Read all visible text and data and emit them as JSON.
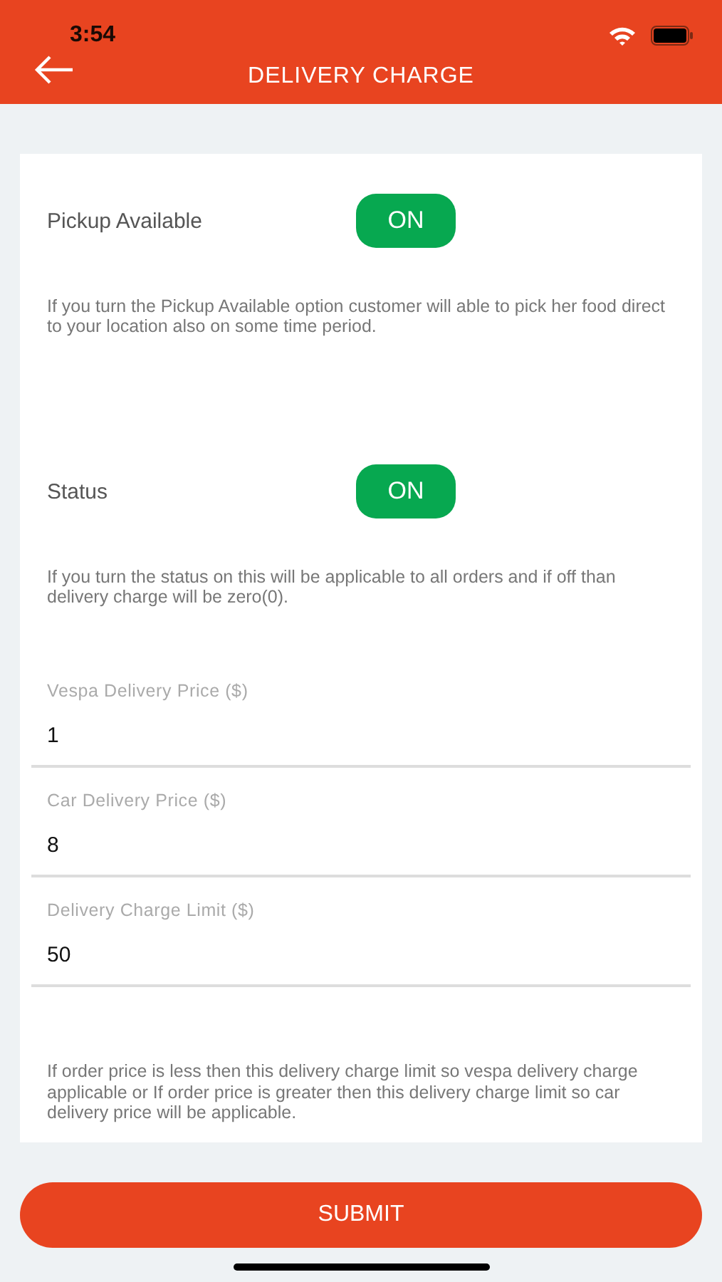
{
  "status_bar": {
    "time": "3:54"
  },
  "header": {
    "title": "DELIVERY CHARGE"
  },
  "toggles": [
    {
      "label": "Pickup Available",
      "on": true,
      "switch_text": "ON",
      "description": "If you turn the Pickup Available option customer will able to pick her food direct to your location also on some time period."
    },
    {
      "label": "Status",
      "on": true,
      "switch_text": "ON",
      "description": "If you turn the status on this will be applicable to all orders and if off than delivery charge will be zero(0)."
    }
  ],
  "fields": [
    {
      "label": "Vespa Delivery Price ($)",
      "value": "1"
    },
    {
      "label": "Car Delivery Price ($)",
      "value": "8"
    },
    {
      "label": "Delivery Charge Limit ($)",
      "value": "50"
    }
  ],
  "note": "If order price is less then this delivery charge limit so vespa delivery charge applicable or If order price is greater then this delivery charge limit so car delivery price will be applicable.",
  "submit_button": "SUBMIT"
}
